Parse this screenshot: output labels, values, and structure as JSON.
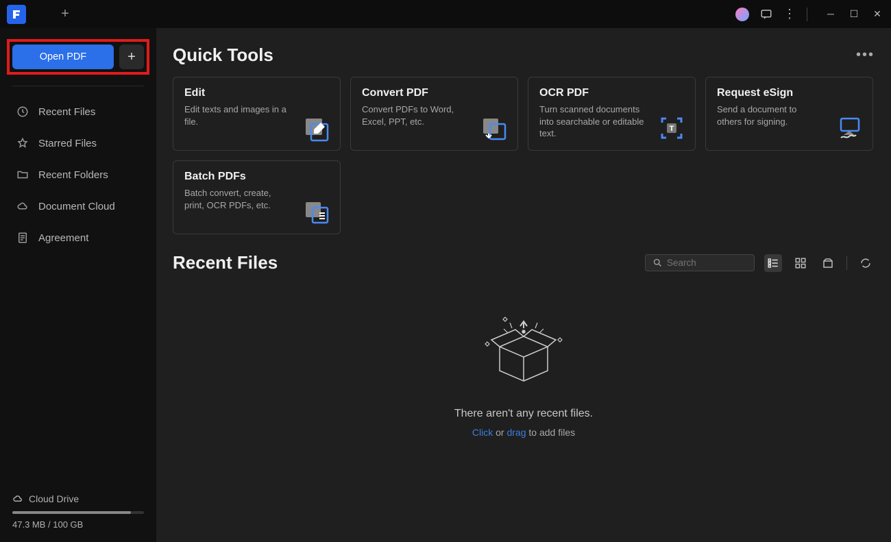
{
  "titlebar": {
    "app_logo_text": "F",
    "new_tab": "+"
  },
  "sidebar": {
    "open_button": "Open PDF",
    "new_button": "+",
    "items": [
      {
        "icon": "clock-icon",
        "label": "Recent Files"
      },
      {
        "icon": "star-icon",
        "label": "Starred Files"
      },
      {
        "icon": "folder-icon",
        "label": "Recent Folders"
      },
      {
        "icon": "cloud-icon",
        "label": "Document Cloud"
      },
      {
        "icon": "doc-icon",
        "label": "Agreement"
      }
    ],
    "cloud": {
      "label": "Cloud Drive",
      "used": "47.3 MB",
      "total": "100 GB",
      "usage_text": "47.3 MB / 100 GB",
      "percent": 90
    }
  },
  "quick_tools": {
    "heading": "Quick Tools",
    "cards": [
      {
        "title": "Edit",
        "desc": "Edit texts and images in a file."
      },
      {
        "title": "Convert PDF",
        "desc": "Convert PDFs to Word, Excel, PPT, etc."
      },
      {
        "title": "OCR PDF",
        "desc": "Turn scanned documents into searchable or editable text."
      },
      {
        "title": "Request eSign",
        "desc": "Send a document to others for signing."
      },
      {
        "title": "Batch PDFs",
        "desc": "Batch convert, create, print, OCR PDFs, etc."
      }
    ]
  },
  "recent_files": {
    "heading": "Recent Files",
    "search_placeholder": "Search",
    "empty_text": "There aren't any recent files.",
    "empty_click": "Click",
    "empty_or": " or ",
    "empty_drag": "drag",
    "empty_rest": " to add files"
  }
}
